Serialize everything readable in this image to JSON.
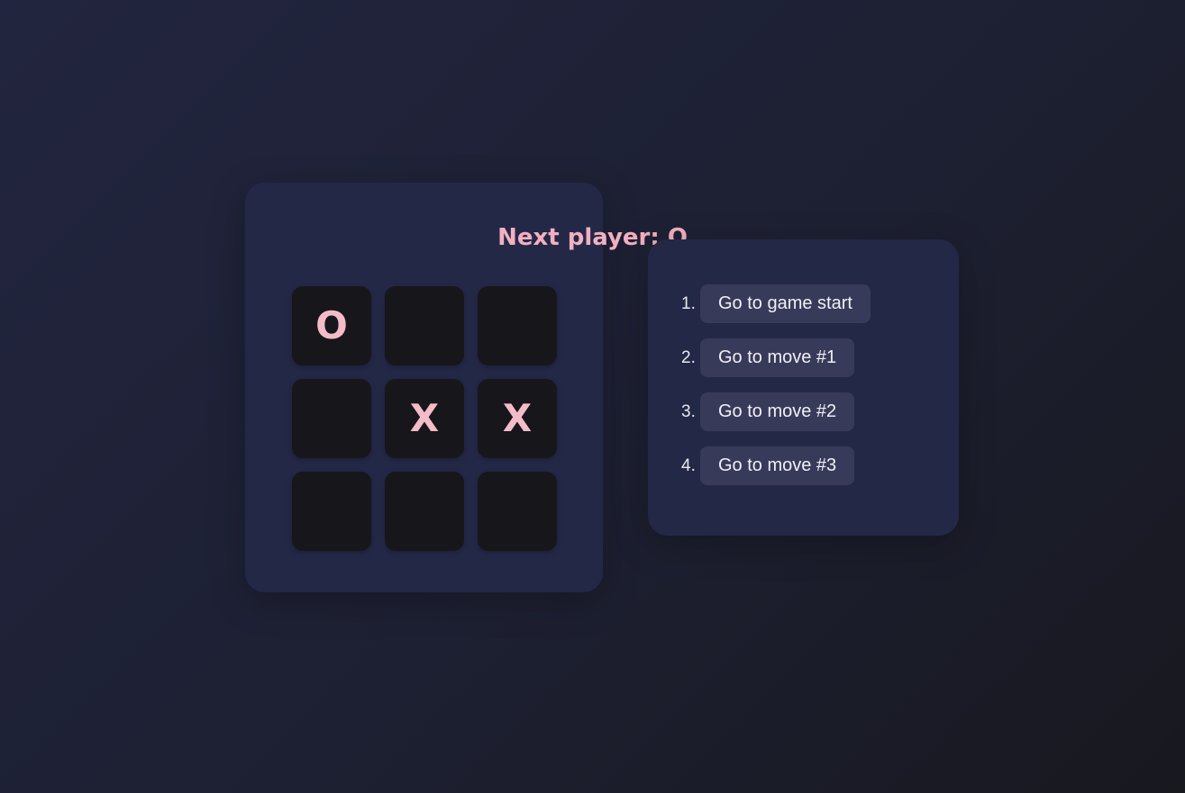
{
  "game": {
    "status": "Next player: O",
    "squares": [
      "O",
      "",
      "",
      "",
      "X",
      "X",
      "",
      "",
      ""
    ]
  },
  "history": {
    "moves": [
      {
        "number": "1.",
        "label": "Go to game start"
      },
      {
        "number": "2.",
        "label": "Go to move #1"
      },
      {
        "number": "3.",
        "label": "Go to move #2"
      },
      {
        "number": "4.",
        "label": "Go to move #3"
      }
    ]
  },
  "colors": {
    "accent": "#f2b0c0",
    "card": "#242847",
    "square": "#17161b",
    "button": "#383a5a"
  }
}
